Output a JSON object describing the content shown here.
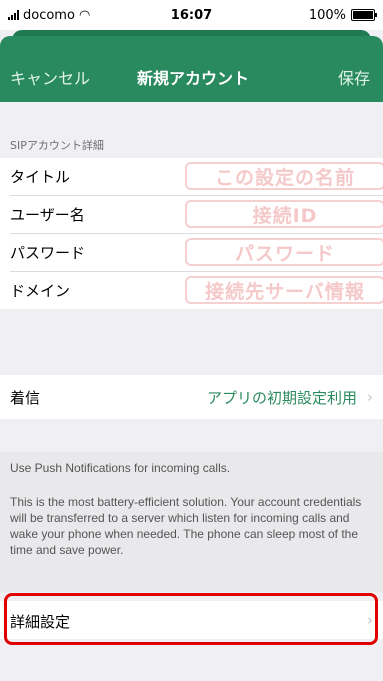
{
  "status_bar": {
    "carrier": "docomo",
    "time": "16:07",
    "battery": "100%"
  },
  "nav": {
    "cancel": "キャンセル",
    "title": "新規アカウント",
    "save": "保存"
  },
  "sip_section": {
    "header": "SIPアカウント詳細",
    "rows": [
      {
        "label": "タイトル",
        "hint": "この設定の名前"
      },
      {
        "label": "ユーザー名",
        "hint": "接続ID"
      },
      {
        "label": "パスワード",
        "hint": "パスワード"
      },
      {
        "label": "ドメイン",
        "hint": "接続先サーバ情報"
      }
    ]
  },
  "incoming": {
    "label": "着信",
    "value": "アプリの初期設定利用"
  },
  "info": {
    "line1": "Use Push Notifications for incoming calls.",
    "line2": "This is the most battery-efficient solution. Your account credentials will be transferred to a server which listen for incoming calls and wake your phone when needed. The phone can sleep most of the time and save power."
  },
  "advanced": {
    "label": "詳細設定"
  },
  "colors": {
    "nav_green": "#2a8a5f",
    "highlight_red": "#e00000",
    "hint_pink": "#f6cfcf"
  }
}
